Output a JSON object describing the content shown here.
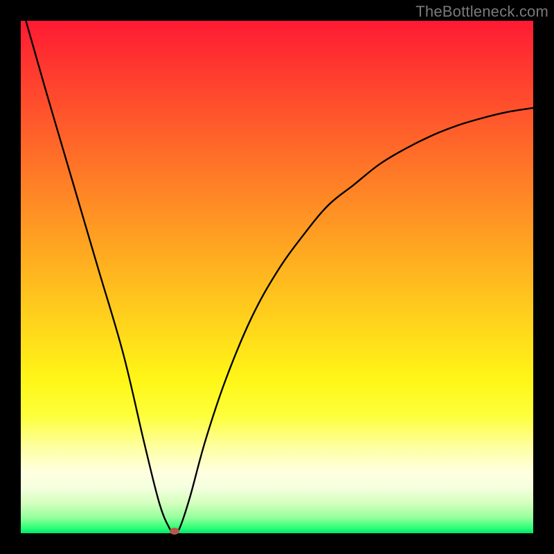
{
  "watermark": "TheBottleneck.com",
  "chart_data": {
    "type": "line",
    "title": "",
    "xlabel": "",
    "ylabel": "",
    "xlim": [
      0,
      100
    ],
    "ylim": [
      0,
      100
    ],
    "grid": false,
    "series": [
      {
        "name": "bottleneck-curve",
        "x": [
          1,
          5,
          10,
          15,
          20,
          24,
          27,
          29,
          30,
          31,
          33,
          36,
          40,
          45,
          50,
          55,
          60,
          65,
          70,
          75,
          80,
          85,
          90,
          95,
          100
        ],
        "y": [
          100,
          86,
          69,
          52,
          35,
          18,
          6,
          1,
          0,
          1,
          7,
          18,
          30,
          42,
          51,
          58,
          64,
          68,
          72,
          75,
          77.5,
          79.5,
          81,
          82.2,
          83
        ]
      }
    ],
    "marker": {
      "x": 30,
      "y": 0,
      "color": "#b35a4a"
    },
    "colors": {
      "curve": "#000000",
      "gradient_top": "#ff1a33",
      "gradient_bottom": "#00e56a",
      "frame": "#000000"
    }
  }
}
